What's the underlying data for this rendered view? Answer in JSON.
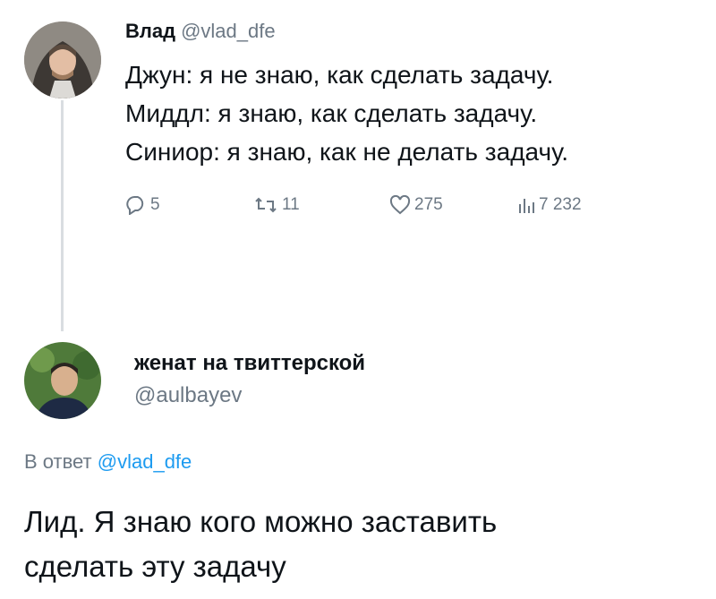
{
  "tweet1": {
    "author_name": "Влад",
    "author_handle": "@vlad_dfe",
    "lines": [
      "Джун: я не знаю, как сделать задачу.",
      "Миддл: я знаю, как сделать задачу.",
      "Синиор: я знаю, как не делать задачу."
    ],
    "stats": {
      "replies": "5",
      "retweets": "11",
      "likes": "275",
      "views": "7 232"
    }
  },
  "tweet2": {
    "author_name": "женат на твиттерской",
    "author_handle": "@aulbayev",
    "reply_prefix": "В ответ",
    "reply_mention": "@vlad_dfe",
    "lines": [
      "Лид. Я знаю кого можно заставить",
      "сделать эту задачу"
    ]
  },
  "icons": {
    "reply": "reply-icon",
    "retweet": "retweet-icon",
    "like": "heart-icon",
    "views": "views-icon"
  },
  "colors": {
    "text": "#0f1419",
    "muted": "#6c7884",
    "link": "#1d9bf0",
    "thread_line": "#d9dde1"
  }
}
